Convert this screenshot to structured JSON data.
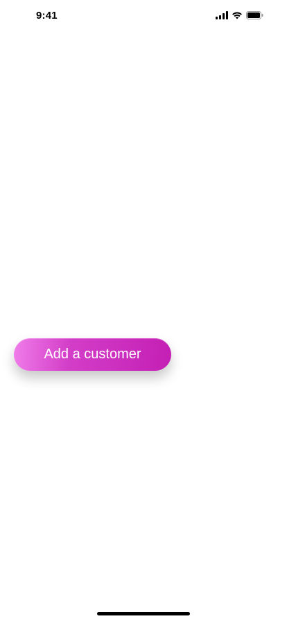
{
  "status_bar": {
    "time": "9:41",
    "icons": [
      "cellular-signal-icon",
      "wifi-icon",
      "battery-icon"
    ]
  },
  "main": {
    "cta_label": "Add a customer"
  },
  "colors": {
    "accent_start": "#f07de9",
    "accent_end": "#c41fb4"
  }
}
